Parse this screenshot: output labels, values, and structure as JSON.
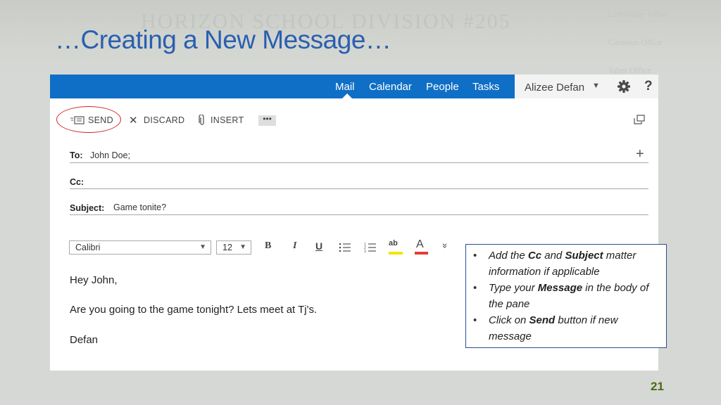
{
  "slide": {
    "title": "…Creating a New Message…",
    "watermark": "HORIZON SCHOOL DIVISION #205",
    "watermark_right": [
      "Lethbridge Office",
      "Cardston Office",
      "Taber Office"
    ],
    "page_number": "21"
  },
  "app": {
    "nav": [
      "Mail",
      "Calendar",
      "People",
      "Tasks"
    ],
    "active_nav": "Mail",
    "user_name": "Alizee Defan",
    "help_label": "?",
    "toolbar": {
      "send": "SEND",
      "discard": "DISCARD",
      "insert": "INSERT",
      "more": "•••"
    },
    "fields": {
      "to_label": "To:",
      "to_value": "John Doe;",
      "cc_label": "Cc:",
      "cc_value": "",
      "subject_label": "Subject:",
      "subject_value": "Game tonite?",
      "add_label": "+"
    },
    "format": {
      "font": "Calibri",
      "size": "12",
      "bold": "B",
      "italic": "I",
      "underline": "U",
      "highlight": "ab",
      "font_color": "A",
      "more": "»"
    },
    "body": {
      "greeting": "Hey John,",
      "line": "Are you going to the game tonight? Lets meet at Tj's.",
      "signature": "Defan"
    }
  },
  "note": {
    "items": [
      {
        "pre": "Add the ",
        "b1": "Cc",
        "mid": " and ",
        "b2": "Subject",
        "post": " matter information if applicable"
      },
      {
        "pre": "Type your ",
        "b1": "Message",
        "post": " in the body of the pane"
      },
      {
        "pre": "Click on ",
        "b1": "Send",
        "post": " button if new message"
      }
    ]
  },
  "colors": {
    "title": "#2a5fb0",
    "topbar": "#0f6fc6",
    "highlight_oval": "#d0282b",
    "note_border": "#2a4f8f",
    "page_number": "#4a6a12",
    "font_color_bar": "#e53b3b",
    "highlight_bar": "#f2e600"
  }
}
